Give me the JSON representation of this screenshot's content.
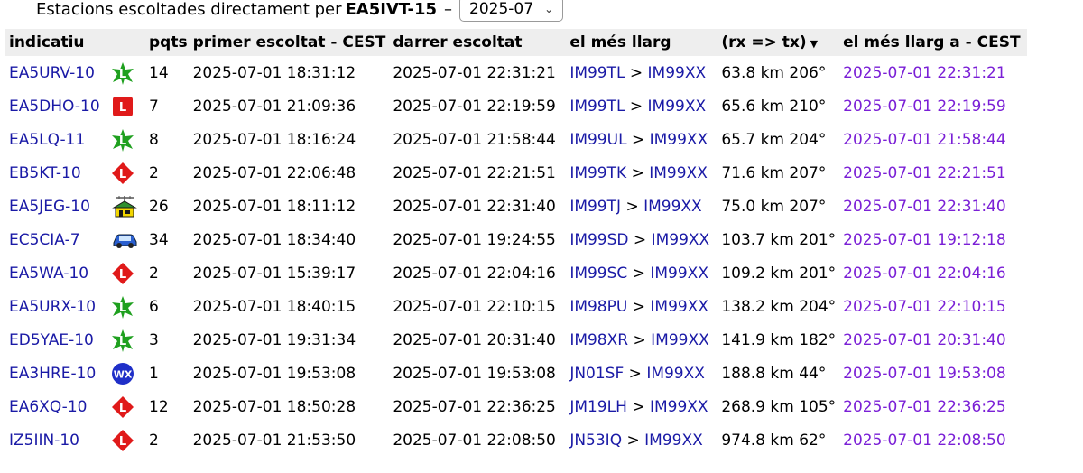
{
  "header": {
    "title": "Estacions escoltades directament per",
    "callsign": "EA5IVT-15",
    "separator": "–",
    "period": "2025-07"
  },
  "columns": {
    "call": "indicatiu",
    "pkts": "pqts",
    "first": "primer escoltat - CEST",
    "last": "darrer escoltat",
    "longest": "el més llarg",
    "dist": "(rx => tx)",
    "longest_at": "el més llarg a - CEST"
  },
  "sort_icon": "sort-down-icon",
  "rows": [
    {
      "call": "EA5URV-10",
      "sym": "green-star-L",
      "pkts": "14",
      "first": "2025-07-01 18:31:12",
      "last": "2025-07-01 22:31:21",
      "rx": "IM99TL",
      "gt": ">",
      "tx": "IM99XX",
      "dist": "63.8 km 206°",
      "at": "2025-07-01 22:31:21"
    },
    {
      "call": "EA5DHO-10",
      "sym": "red-square-L",
      "pkts": "7",
      "first": "2025-07-01 21:09:36",
      "last": "2025-07-01 22:19:59",
      "rx": "IM99TL",
      "gt": ">",
      "tx": "IM99XX",
      "dist": "65.6 km 210°",
      "at": "2025-07-01 22:19:59"
    },
    {
      "call": "EA5LQ-11",
      "sym": "green-star-L",
      "pkts": "8",
      "first": "2025-07-01 18:16:24",
      "last": "2025-07-01 21:58:44",
      "rx": "IM99UL",
      "gt": ">",
      "tx": "IM99XX",
      "dist": "65.7 km 204°",
      "at": "2025-07-01 21:58:44"
    },
    {
      "call": "EB5KT-10",
      "sym": "red-diamond-L",
      "pkts": "2",
      "first": "2025-07-01 22:06:48",
      "last": "2025-07-01 22:21:51",
      "rx": "IM99TK",
      "gt": ">",
      "tx": "IM99XX",
      "dist": "71.6 km 207°",
      "at": "2025-07-01 22:21:51"
    },
    {
      "call": "EA5JEG-10",
      "sym": "house-antenna",
      "pkts": "26",
      "first": "2025-07-01 18:11:12",
      "last": "2025-07-01 22:31:40",
      "rx": "IM99TJ",
      "gt": ">",
      "tx": "IM99XX",
      "dist": "75.0 km 207°",
      "at": "2025-07-01 22:31:40"
    },
    {
      "call": "EC5CIA-7",
      "sym": "car",
      "pkts": "34",
      "first": "2025-07-01 18:34:40",
      "last": "2025-07-01 19:24:55",
      "rx": "IM99SD",
      "gt": ">",
      "tx": "IM99XX",
      "dist": "103.7 km 201°",
      "at": "2025-07-01 19:12:18"
    },
    {
      "call": "EA5WA-10",
      "sym": "red-diamond-L",
      "pkts": "2",
      "first": "2025-07-01 15:39:17",
      "last": "2025-07-01 22:04:16",
      "rx": "IM99SC",
      "gt": ">",
      "tx": "IM99XX",
      "dist": "109.2 km 201°",
      "at": "2025-07-01 22:04:16"
    },
    {
      "call": "EA5URX-10",
      "sym": "green-star-L",
      "pkts": "6",
      "first": "2025-07-01 18:40:15",
      "last": "2025-07-01 22:10:15",
      "rx": "IM98PU",
      "gt": ">",
      "tx": "IM99XX",
      "dist": "138.2 km 204°",
      "at": "2025-07-01 22:10:15"
    },
    {
      "call": "ED5YAE-10",
      "sym": "green-star-L",
      "pkts": "3",
      "first": "2025-07-01 19:31:34",
      "last": "2025-07-01 20:31:40",
      "rx": "IM98XR",
      "gt": ">",
      "tx": "IM99XX",
      "dist": "141.9 km 182°",
      "at": "2025-07-01 20:31:40"
    },
    {
      "call": "EA3HRE-10",
      "sym": "wx-circle",
      "pkts": "1",
      "first": "2025-07-01 19:53:08",
      "last": "2025-07-01 19:53:08",
      "rx": "JN01SF",
      "gt": ">",
      "tx": "IM99XX",
      "dist": "188.8 km 44°",
      "at": "2025-07-01 19:53:08"
    },
    {
      "call": "EA6XQ-10",
      "sym": "red-diamond-L",
      "pkts": "12",
      "first": "2025-07-01 18:50:28",
      "last": "2025-07-01 22:36:25",
      "rx": "JM19LH",
      "gt": ">",
      "tx": "IM99XX",
      "dist": "268.9 km 105°",
      "at": "2025-07-01 22:36:25"
    },
    {
      "call": "IZ5IIN-10",
      "sym": "red-diamond-L",
      "pkts": "2",
      "first": "2025-07-01 21:53:50",
      "last": "2025-07-01 22:08:50",
      "rx": "JN53IQ",
      "gt": ">",
      "tx": "IM99XX",
      "dist": "974.8 km 62°",
      "at": "2025-07-01 22:08:50"
    }
  ],
  "symbol_text": {
    "L": "L",
    "WX": "WX"
  },
  "colors": {
    "link": "#1a1aa6",
    "purple": "#7a1fd6",
    "header_bg": "#eeeeee",
    "green": "#1fa01f",
    "red": "#e01a1a",
    "blue": "#1f2fc8"
  }
}
